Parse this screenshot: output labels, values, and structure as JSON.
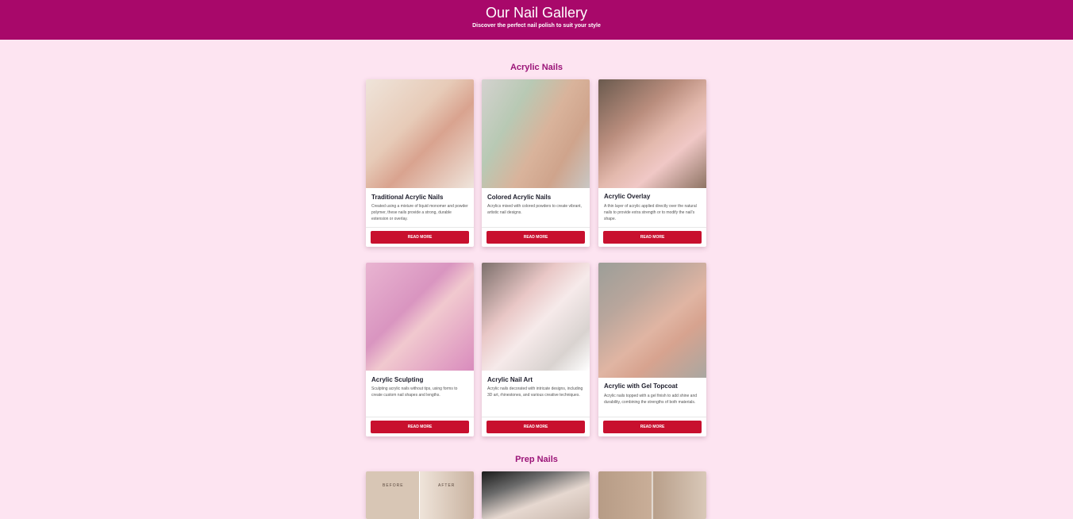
{
  "header": {
    "title": "Our Nail Gallery",
    "subtitle": "Discover the perfect nail polish to suit your style"
  },
  "sections": [
    {
      "title": "Acrylic Nails",
      "cards": [
        {
          "name": "Traditional Acrylic Nails",
          "description": "Created using a mixture of liquid monomer and powder polymer, these nails provide a strong, durable extension or overlay.",
          "button": "READ MORE"
        },
        {
          "name": "Colored Acrylic Nails",
          "description": "Acrylics mixed with colored powders to create vibrant, artistic nail designs.",
          "button": "READ MORE"
        },
        {
          "name": "Acrylic Overlay",
          "description": "A thin layer of acrylic applied directly over the natural nails to provide extra strength or to modify the nail's shape.",
          "button": "READ MORE"
        },
        {
          "name": "Acrylic Sculpting",
          "description": "Sculpting acrylic nails without tips, using forms to create custom nail shapes and lengths.",
          "button": "READ MORE"
        },
        {
          "name": "Acrylic Nail Art",
          "description": "Acrylic nails decorated with intricate designs, including 3D art, rhinestones, and various creative techniques.",
          "button": "READ MORE"
        },
        {
          "name": "Acrylic with Gel Topcoat",
          "description": "Acrylic nails topped with a gel finish to add shine and durability, combining the strengths of both materials.",
          "button": "READ MORE"
        }
      ]
    },
    {
      "title": "Prep Nails",
      "image_labels": {
        "before": "BEFORE",
        "after": "AFTER"
      }
    }
  ]
}
